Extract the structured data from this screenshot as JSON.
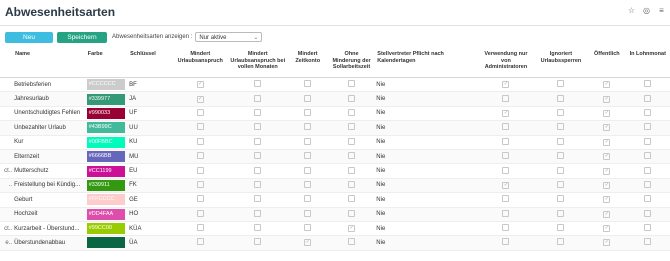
{
  "page": {
    "title": "Abwesenheitsarten"
  },
  "toolbar": {
    "new_label": "Neu",
    "save_label": "Speichern",
    "filter_label": "Abwesenheitsarten anzeigen :",
    "filter_value": "Nur aktive"
  },
  "colors": {
    "new_button": "#3fbde0",
    "save_button": "#25a382"
  },
  "columns": {
    "name": "Name",
    "farbe": "Farbe",
    "schluessel": "Schlüssel",
    "mindert_urlaubsanspruch": "Mindert Urlaubsanspruch",
    "mindert_urlaubsanspruch_vollen": "Mindert Urlaubsanspruch bei vollen Monaten",
    "mindert_zeitkonto": "Mindert Zeitkonto",
    "ohne_minderung": "Ohne Minderung der Sollarbeitszeit",
    "stellvertreter": "Stellvertreter Pflicht nach Kalendertagen",
    "verwendung_admin": "Verwendung nur von Administratoren",
    "ignoriert_urlaubssperren": "Ignoriert Urlaubssperren",
    "oeffentlich": "Öffentlich",
    "in_lohnmonat": "In Lohnmonat"
  },
  "rows": [
    {
      "prefix": "",
      "name": "Betriebsferien",
      "color": "#CCCCCC",
      "color_label": "#CCCCCC",
      "key": "BF",
      "vertreter": "Nie",
      "checks": [
        1,
        0,
        0,
        0,
        1,
        0,
        1,
        0
      ]
    },
    {
      "prefix": "",
      "name": "Jahresurlaub",
      "color": "#339977",
      "color_label": "#339977",
      "key": "JA",
      "vertreter": "Nie",
      "checks": [
        1,
        0,
        0,
        0,
        0,
        0,
        1,
        0
      ]
    },
    {
      "prefix": "",
      "name": "Unentschuldigtes Fehlen",
      "color": "#990033",
      "color_label": "#990033",
      "key": "UF",
      "vertreter": "Nie",
      "checks": [
        0,
        0,
        0,
        0,
        1,
        0,
        1,
        0
      ]
    },
    {
      "prefix": "",
      "name": "Unbezahlter Urlaub",
      "color": "#43B99C",
      "color_label": "#43B99C",
      "key": "UU",
      "vertreter": "Nie",
      "checks": [
        0,
        0,
        0,
        0,
        0,
        0,
        1,
        0
      ]
    },
    {
      "prefix": "",
      "name": "Kur",
      "color": "#00FBBC",
      "color_label": "#00FBBC",
      "key": "KU",
      "vertreter": "Nie",
      "checks": [
        0,
        0,
        0,
        0,
        0,
        0,
        1,
        0
      ]
    },
    {
      "prefix": "",
      "name": "Elternzeit",
      "color": "#6666BB",
      "color_label": "#6666BB",
      "key": "MU",
      "vertreter": "Nie",
      "checks": [
        0,
        0,
        0,
        0,
        0,
        0,
        1,
        0
      ]
    },
    {
      "prefix": "ct..",
      "name": "Mutterschutz",
      "color": "#CC1199",
      "color_label": "#CC1199",
      "key": "EU",
      "vertreter": "Nie",
      "checks": [
        0,
        0,
        0,
        0,
        0,
        0,
        1,
        0
      ]
    },
    {
      "prefix": "..",
      "name": "Freistellung bei Kündig...",
      "color": "#339911",
      "color_label": "#339911",
      "key": "FK",
      "vertreter": "Nie",
      "checks": [
        0,
        0,
        0,
        0,
        1,
        0,
        1,
        0
      ]
    },
    {
      "prefix": "",
      "name": "Geburt",
      "color": "#FFCCCC",
      "color_label": "#FFCCCC",
      "key": "GE",
      "vertreter": "Nie",
      "checks": [
        0,
        0,
        0,
        0,
        0,
        0,
        1,
        0
      ]
    },
    {
      "prefix": "",
      "name": "Hochzeit",
      "color": "#DD4FAA",
      "color_label": "#DD4FAA",
      "key": "HO",
      "vertreter": "Nie",
      "checks": [
        0,
        0,
        0,
        0,
        0,
        0,
        1,
        0
      ]
    },
    {
      "prefix": "ct..",
      "name": "Kurzarbeit - Überstund...",
      "color": "#99CC00",
      "color_label": "#99CC00",
      "key": "KÜA",
      "vertreter": "Nie",
      "checks": [
        0,
        0,
        0,
        1,
        0,
        0,
        1,
        0
      ]
    },
    {
      "prefix": "e..",
      "name": "Überstundenabbau",
      "color": "#0B6644",
      "color_label": "",
      "key": "ÜA",
      "vertreter": "Nie",
      "checks": [
        0,
        0,
        1,
        0,
        0,
        0,
        1,
        0
      ]
    }
  ]
}
